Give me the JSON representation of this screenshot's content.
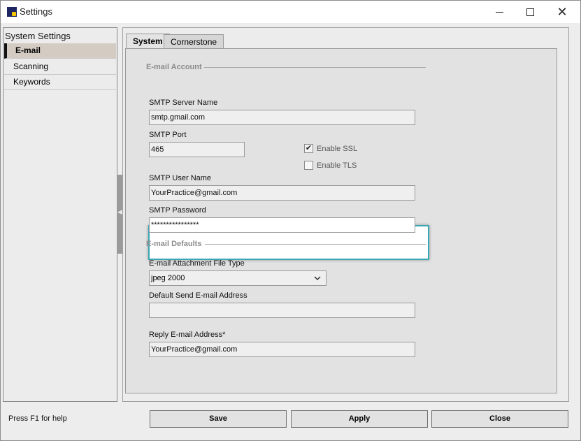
{
  "window": {
    "title": "Settings"
  },
  "sidebar": {
    "header": "System Settings",
    "items": [
      {
        "label": "E-mail",
        "selected": true
      },
      {
        "label": "Scanning",
        "selected": false
      },
      {
        "label": "Keywords",
        "selected": false
      }
    ]
  },
  "tabs": [
    {
      "label": "System",
      "active": true
    },
    {
      "label": "Cornerstone",
      "active": false
    }
  ],
  "email_account": {
    "section_label": "E-mail Account",
    "smtp_server_label": "SMTP Server Name",
    "smtp_server_value": "smtp.gmail.com",
    "smtp_port_label": "SMTP Port",
    "smtp_port_value": "465",
    "enable_ssl_label": "Enable SSL",
    "enable_ssl_checked": true,
    "enable_tls_label": "Enable TLS",
    "enable_tls_checked": false,
    "smtp_user_label": "SMTP User Name",
    "smtp_user_value": "YourPractice@gmail.com",
    "smtp_password_label": "SMTP Password",
    "smtp_password_value": "****************"
  },
  "email_defaults": {
    "section_label": "E-mail Defaults",
    "attachment_type_label": "E-mail Attachment File Type",
    "attachment_type_value": "jpeg 2000",
    "default_send_label": "Default Send E-mail Address",
    "default_send_value": "",
    "reply_label": "Reply E-mail Address*",
    "reply_value": "YourPractice@gmail.com"
  },
  "footer": {
    "help_text": "Press F1 for help",
    "save_label": "Save",
    "apply_label": "Apply",
    "close_label": "Close"
  },
  "colors": {
    "highlight_border": "#3aa7b2",
    "selected_item_bg": "#d4cbc3"
  }
}
